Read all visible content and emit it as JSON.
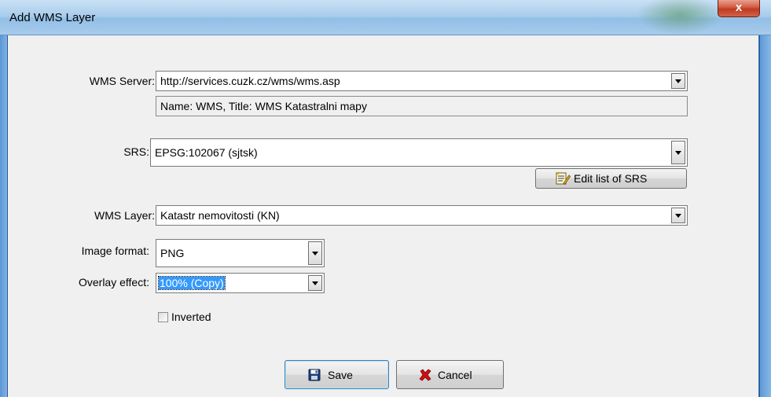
{
  "window": {
    "title": "Add WMS Layer",
    "close_label": "x"
  },
  "form": {
    "wms_server": {
      "label": "WMS Server:",
      "value": "http://services.cuzk.cz/wms/wms.asp",
      "info": "Name: WMS, Title: WMS Katastralni mapy"
    },
    "srs": {
      "label": "SRS:",
      "value": "EPSG:102067 (sjtsk)",
      "edit_button_label": "Edit list of SRS"
    },
    "wms_layer": {
      "label": "WMS Layer:",
      "value": "Katastr nemovitosti (KN)"
    },
    "image_format": {
      "label": "Image format:",
      "value": "PNG"
    },
    "overlay_effect": {
      "label": "Overlay effect:",
      "value": "100% (Copy)"
    },
    "inverted": {
      "label": "Inverted",
      "checked": false
    }
  },
  "actions": {
    "save_label": "Save",
    "cancel_label": "Cancel"
  },
  "icons": {
    "save": "floppy-disk-icon",
    "cancel": "red-x-icon",
    "edit_srs": "edit-list-icon",
    "dropdown": "chevron-down-icon"
  },
  "colors": {
    "selection": "#3399ff",
    "cancel_icon": "#cc1111",
    "save_icon": "#1d3f7a"
  }
}
